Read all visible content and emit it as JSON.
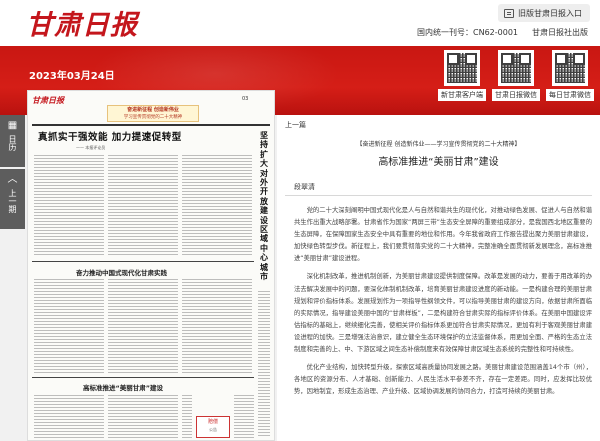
{
  "header": {
    "logo": "甘肃日报",
    "old_site_link": "旧版甘肃日报入口",
    "issn": "国内统一刊号：CN62-0001",
    "publisher": "甘肃日报社出版"
  },
  "banner": {
    "date": "2023年03月24日",
    "qr_codes": [
      {
        "label": "新甘肃客户端"
      },
      {
        "label": "甘肃日报微信"
      },
      {
        "label": "每日甘肃微信"
      }
    ]
  },
  "sidenav": {
    "calendar": {
      "icon": "calendar-icon",
      "label": "日历"
    },
    "prev_page": {
      "icon": "chevron-up-icon",
      "label": "上一期"
    }
  },
  "newspaper": {
    "masthead": "甘肃日报",
    "page_number": "03",
    "promo_title": "奋进新征程 创造新伟业",
    "promo_sub": "学习宣传贯彻党的二十大精神",
    "headline": "真抓实干强效能  加力提速促转型",
    "byline": "—— 本报评论员",
    "vertical_headline": "坚持扩大对外开放  建设区域中心城市",
    "headline2": "奋力推动中国式现代化甘肃实践",
    "headline3": "高标准推进“美丽甘肃”建设",
    "ad_line1": "赔偿",
    "ad_line2": "公告"
  },
  "article": {
    "prev_link": "上一篇",
    "kicker": "【奋进新征程 创造新伟业——学习宣传贯彻党的二十大精神】",
    "title": "高标准推进“美丽甘肃”建设",
    "author": "段翠清",
    "paragraphs": [
      "党的二十大深刻阐明中国式现代化是人与自然和谐共生的现代化，对推动绿色发展、促进人与自然和谐共生作出重大战略部署。甘肃省作为国家“两屏三带”生态安全屏障的重要组成部分，是我国西北地区重要的生态屏障，在保障国家生态安全中具有重要的地位和作用。今年我省政府工作报告提出聚力美丽甘肃建设，加快绿色转型步伐。新征程上，我们要贯彻落实党的二十大精神，完整准确全面贯彻新发展理念，高标准推进“美丽甘肃”建设进程。",
      "深化机制改革，推进机制创新，为美丽甘肃建设提供制度保障。改革是发展的动力，要善于用改革的办法去解决发展中的问题，要深化体制机制改革，培育美丽甘肃建设进度的新动能。一是构建合理的美丽甘肃规划和评价指标体系。发展规划作为一项指导性纲领文件，可以指导美丽甘肃的建设方向，依据甘肃所面临的实际情况，指导建设美丽中国的“甘肃样板”，二是构建符合甘肃实际的指标评价体系。在美丽中国建设评估指标的基础上，继续细化完善，使相关评价指标体系更加符合甘肃实际情况，更加有利于客观美丽甘肃建设进程的加快。三是增强法治意识，建立健全生态环境保护的立法监督体系，用更加全面、严格的生态立法制度和完善的上、中、下游区域之间生态补偿制度来有效保障甘肃区域生态系统的完整性和可持续性。",
      "优化产业结构，加快转型升级，探索区域高质量协同发展之路。美丽甘肃建设范围涵盖14个市（州），各地区的资源分布、人才基础、创新能力、人民生活水平参差不齐，存在一定差距。同时，应发挥比较优势，因地制宜，形成生态治理、产业升级、区域协调发展的协同合力，打造可持续的美丽甘肃。"
    ]
  }
}
